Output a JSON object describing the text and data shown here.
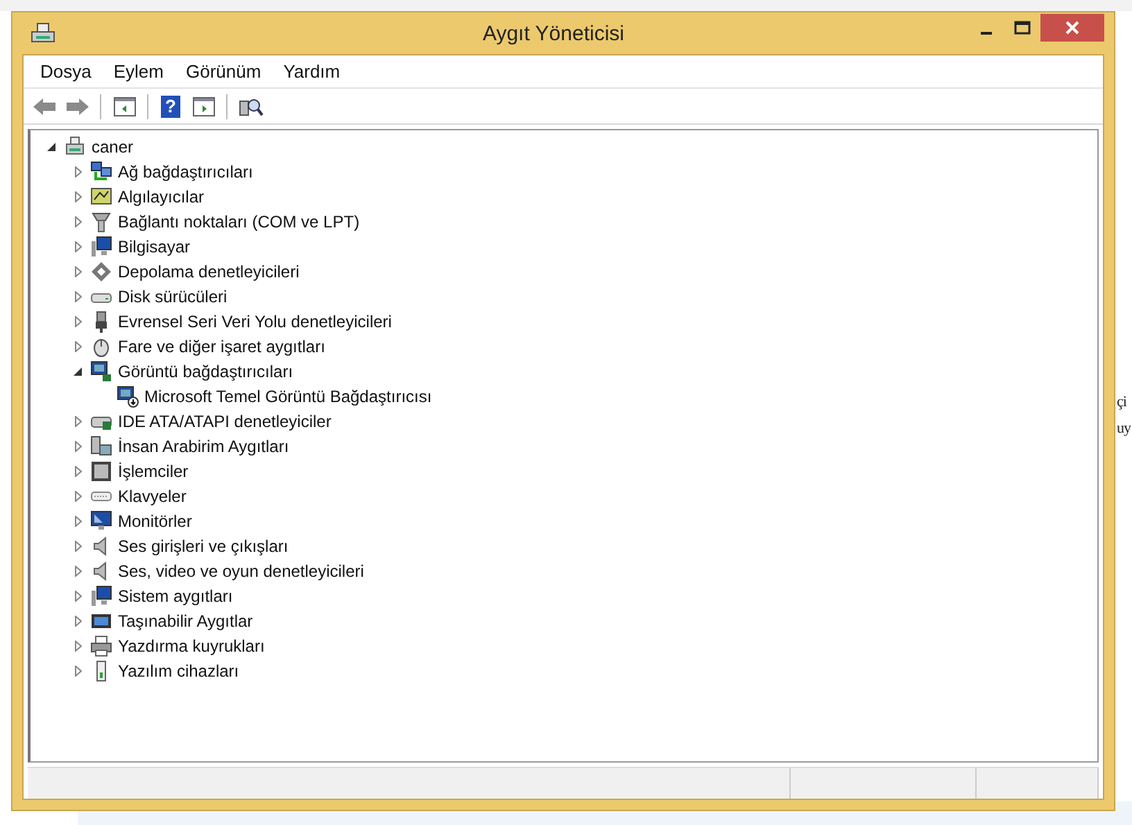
{
  "background": {
    "side_lines": [
      "çi",
      "uy"
    ]
  },
  "toolbar": {
    "help_glyph": "?"
  },
  "window": {
    "title": "Aygıt Yöneticisi"
  },
  "menu": [
    "Dosya",
    "Eylem",
    "Görünüm",
    "Yardım"
  ],
  "tree": [
    {
      "label": "caner",
      "kind": "computer",
      "expanded": true,
      "children": [
        {
          "label": "Ağ bağdaştırıcıları",
          "kind": "network",
          "expanded": false
        },
        {
          "label": "Algılayıcılar",
          "kind": "sensor",
          "expanded": false
        },
        {
          "label": "Bağlantı noktaları (COM ve LPT)",
          "kind": "port",
          "expanded": false
        },
        {
          "label": "Bilgisayar",
          "kind": "system",
          "expanded": false
        },
        {
          "label": "Depolama denetleyicileri",
          "kind": "storage",
          "expanded": false
        },
        {
          "label": "Disk sürücüleri",
          "kind": "disk",
          "expanded": false
        },
        {
          "label": "Evrensel Seri Veri Yolu denetleyicileri",
          "kind": "usb",
          "expanded": false
        },
        {
          "label": "Fare ve diğer işaret aygıtları",
          "kind": "mouse",
          "expanded": false
        },
        {
          "label": "Görüntü bağdaştırıcıları",
          "kind": "display",
          "expanded": true,
          "children": [
            {
              "label": "Microsoft Temel Görüntü Bağdaştırıcısı",
              "kind": "adapter"
            }
          ]
        },
        {
          "label": "IDE ATA/ATAPI denetleyiciler",
          "kind": "ide",
          "expanded": false
        },
        {
          "label": "İnsan Arabirim Aygıtları",
          "kind": "hid",
          "expanded": false
        },
        {
          "label": "İşlemciler",
          "kind": "cpu",
          "expanded": false
        },
        {
          "label": "Klavyeler",
          "kind": "keyboard",
          "expanded": false
        },
        {
          "label": "Monitörler",
          "kind": "monitor",
          "expanded": false
        },
        {
          "label": "Ses girişleri ve çıkışları",
          "kind": "audio",
          "expanded": false
        },
        {
          "label": "Ses, video ve oyun denetleyicileri",
          "kind": "audio",
          "expanded": false
        },
        {
          "label": "Sistem aygıtları",
          "kind": "system",
          "expanded": false
        },
        {
          "label": "Taşınabilir Aygıtlar",
          "kind": "portable",
          "expanded": false
        },
        {
          "label": "Yazdırma kuyrukları",
          "kind": "printer",
          "expanded": false
        },
        {
          "label": "Yazılım cihazları",
          "kind": "software",
          "expanded": false
        }
      ]
    }
  ]
}
